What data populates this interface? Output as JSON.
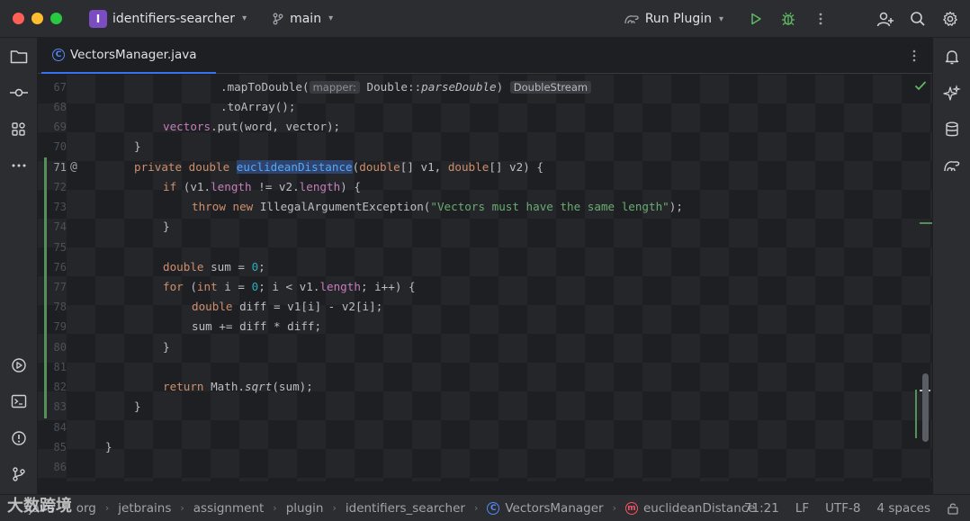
{
  "window": {
    "project_badge": "I",
    "project_name": "identifiers-searcher",
    "branch": "main",
    "run_config": "Run Plugin"
  },
  "tab": {
    "file_name": "VectorsManager.java",
    "icon": "class-icon"
  },
  "editor": {
    "lines": [
      {
        "n": "67"
      },
      {
        "n": "68"
      },
      {
        "n": "69"
      },
      {
        "n": "70"
      },
      {
        "n": "71"
      },
      {
        "n": "72"
      },
      {
        "n": "73"
      },
      {
        "n": "74"
      },
      {
        "n": "75"
      },
      {
        "n": "76"
      },
      {
        "n": "77"
      },
      {
        "n": "78"
      },
      {
        "n": "79"
      },
      {
        "n": "80"
      },
      {
        "n": "81"
      },
      {
        "n": "82"
      },
      {
        "n": "83"
      },
      {
        "n": "84"
      },
      {
        "n": "85"
      },
      {
        "n": "86"
      }
    ],
    "inlay_param": "mapper:",
    "inlay_type": "DoubleStream",
    "tokens": {
      "l67_a": ".mapToDouble(",
      "l67_b": "Double::",
      "l67_c": "parseDouble",
      "l67_d": ")",
      "l68": ".toArray();",
      "l69_a": "vectors",
      "l69_b": ".put(word, vector);",
      "l70": "}",
      "l71_kw1": "private double ",
      "l71_fn": "euclideanDistance",
      "l71_a": "(",
      "l71_kw2": "double",
      "l71_b": "[] v1, ",
      "l71_kw3": "double",
      "l71_c": "[] v2) {",
      "l72_kw": "if",
      "l72_a": " (v1.",
      "l72_f1": "length",
      "l72_b": " != v2.",
      "l72_f2": "length",
      "l72_c": ") {",
      "l73_kw": "throw new ",
      "l73_a": "IllegalArgumentException(",
      "l73_str": "\"Vectors must have the same length\"",
      "l73_b": ");",
      "l74": "}",
      "l76_kw": "double",
      "l76_a": " sum = ",
      "l76_num": "0",
      "l76_b": ";",
      "l77_kw": "for",
      "l77_a": " (",
      "l77_kw2": "int",
      "l77_b": " i = ",
      "l77_num": "0",
      "l77_c": "; i < v1.",
      "l77_f": "length",
      "l77_d": "; i++) {",
      "l78_kw": "double",
      "l78_a": " diff = v1[i] - v2[i];",
      "l79": "sum += diff * diff;",
      "l80": "}",
      "l82_kw": "return",
      "l82_a": " Math.",
      "l82_it": "sqrt",
      "l82_b": "(sum);",
      "l83": "}",
      "l85": "}"
    }
  },
  "statusbar": {
    "breadcrumbs": [
      "java",
      "org",
      "jetbrains",
      "assignment",
      "plugin",
      "identifiers_searcher",
      "VectorsManager",
      "euclideanDistance"
    ],
    "position": "71:21",
    "line_sep": "LF",
    "encoding": "UTF-8",
    "indent": "4 spaces"
  },
  "watermark": "大数跨境",
  "colors": {
    "accent": "#3574f0",
    "keyword": "#cf8e6d",
    "string": "#6aab73",
    "number": "#2aacb8",
    "field": "#c77dbb",
    "change": "#549159"
  }
}
